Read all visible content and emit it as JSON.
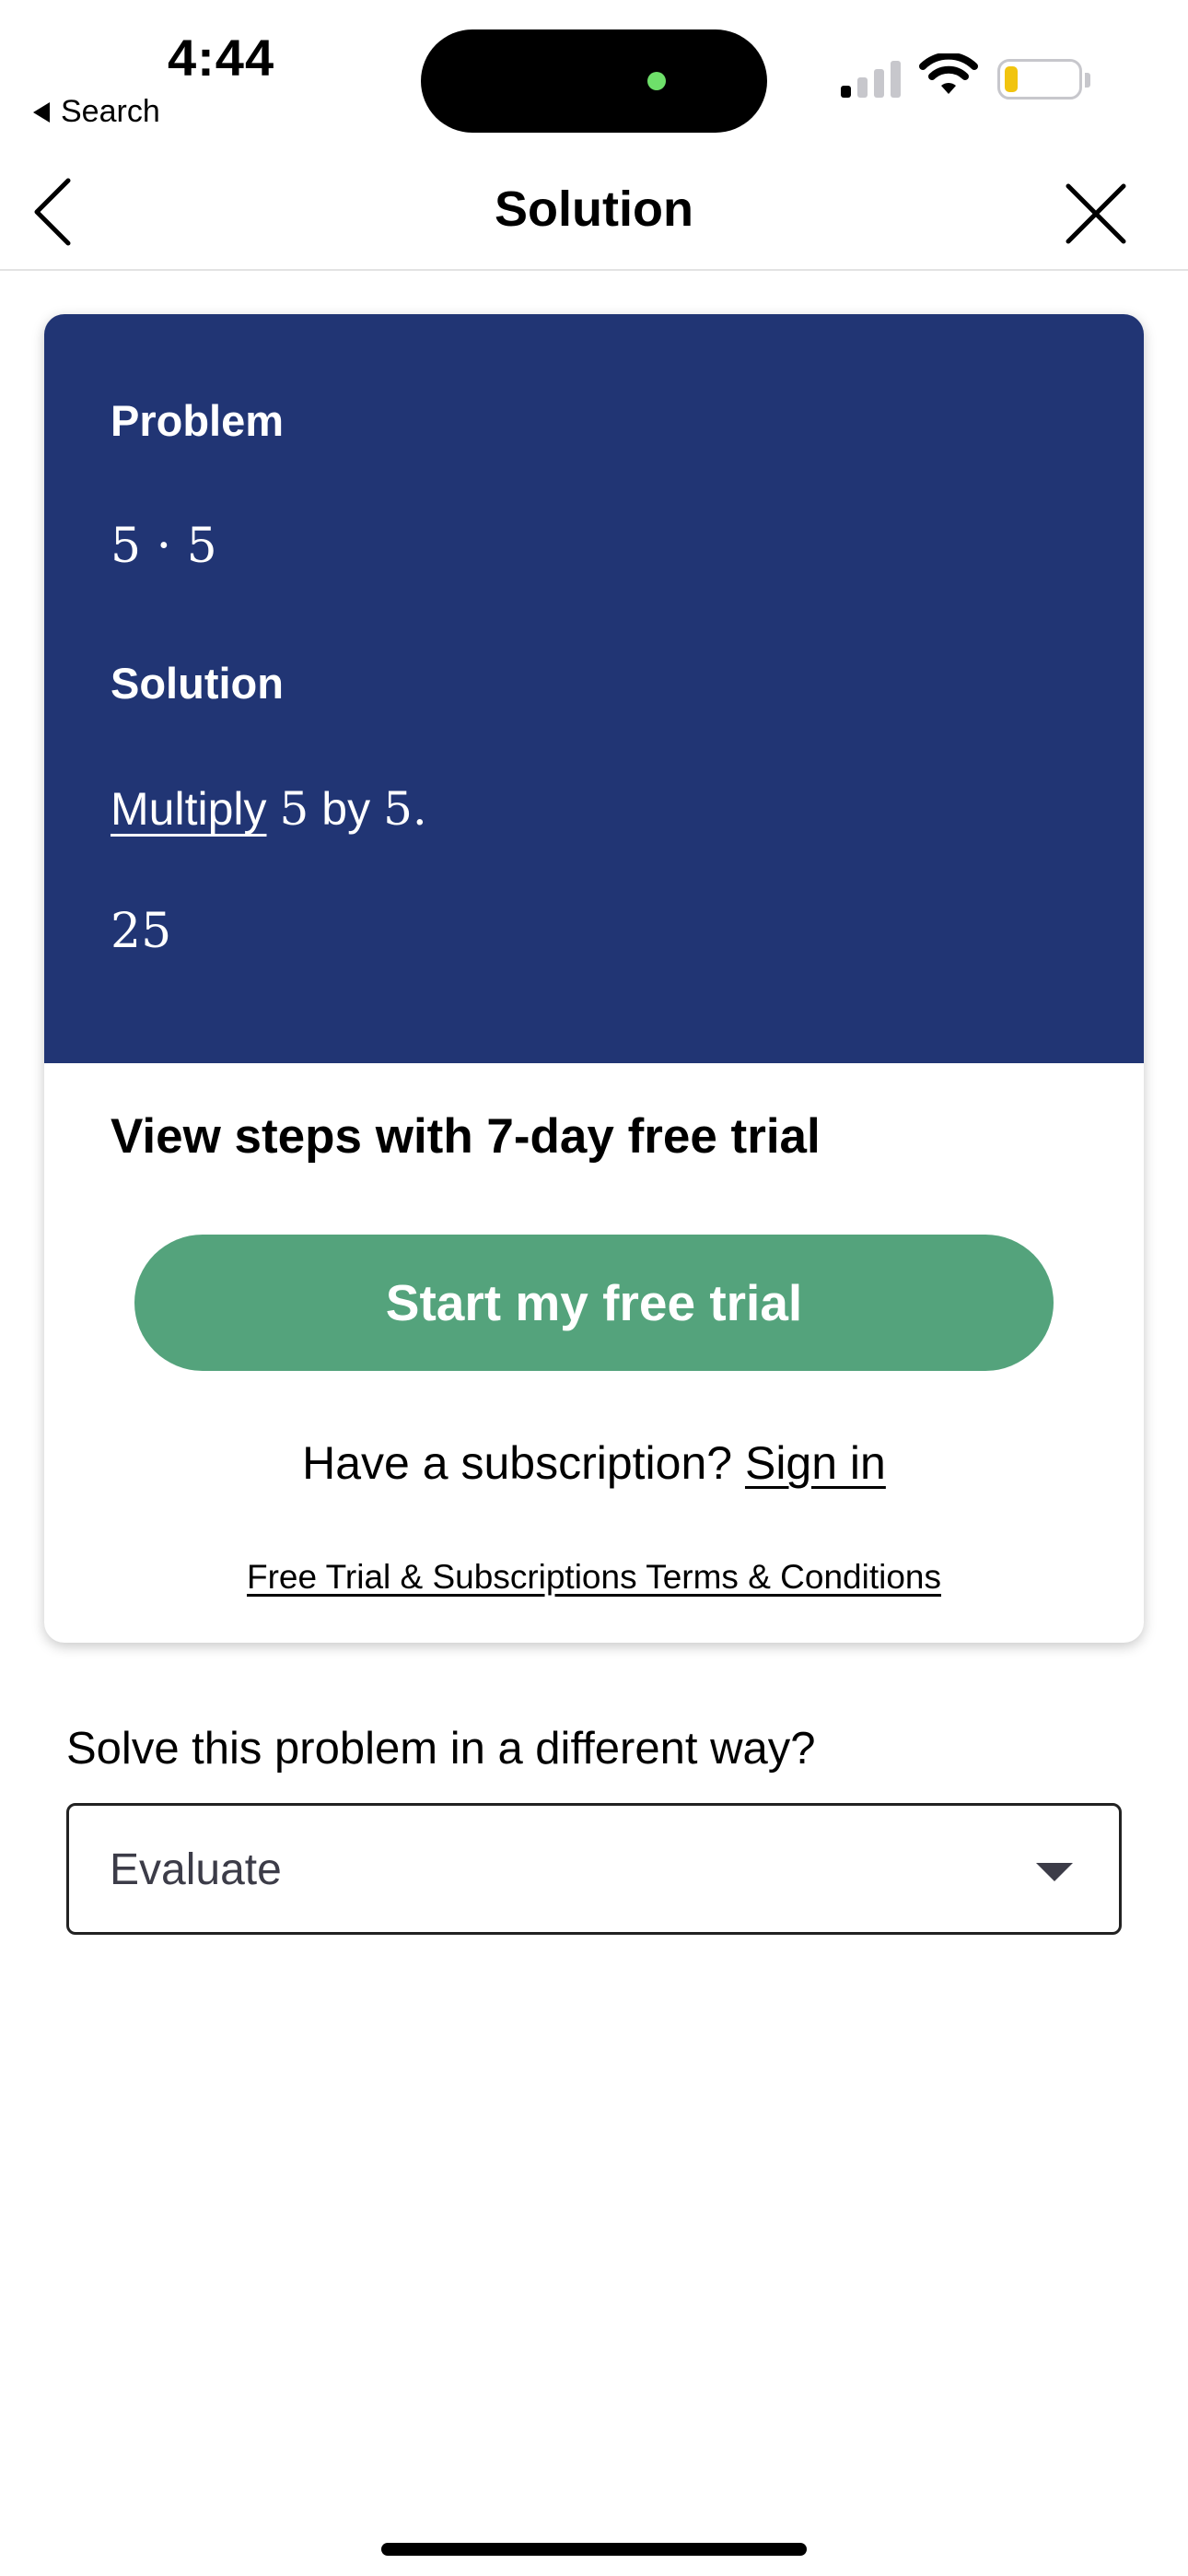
{
  "status_bar": {
    "time": "4:44",
    "back_app": "Search"
  },
  "nav": {
    "title": "Solution"
  },
  "solution_card": {
    "problem_label": "Problem",
    "problem_expr": "5 · 5",
    "solution_label": "Solution",
    "step_action": "Multiply",
    "step_a": "5",
    "step_by": "by",
    "step_b": "5.",
    "result": "25"
  },
  "trial": {
    "title": "View steps with 7-day free trial",
    "button_label": "Start my free trial",
    "subscription_prompt": "Have a subscription?",
    "sign_in_label": "Sign in",
    "terms_link": "Free Trial & Subscriptions Terms & Conditions"
  },
  "alternate": {
    "question": "Solve this problem in a different way?",
    "selected_method": "Evaluate"
  },
  "colors": {
    "card_background": "#213574",
    "trial_button": "#54a37c"
  }
}
